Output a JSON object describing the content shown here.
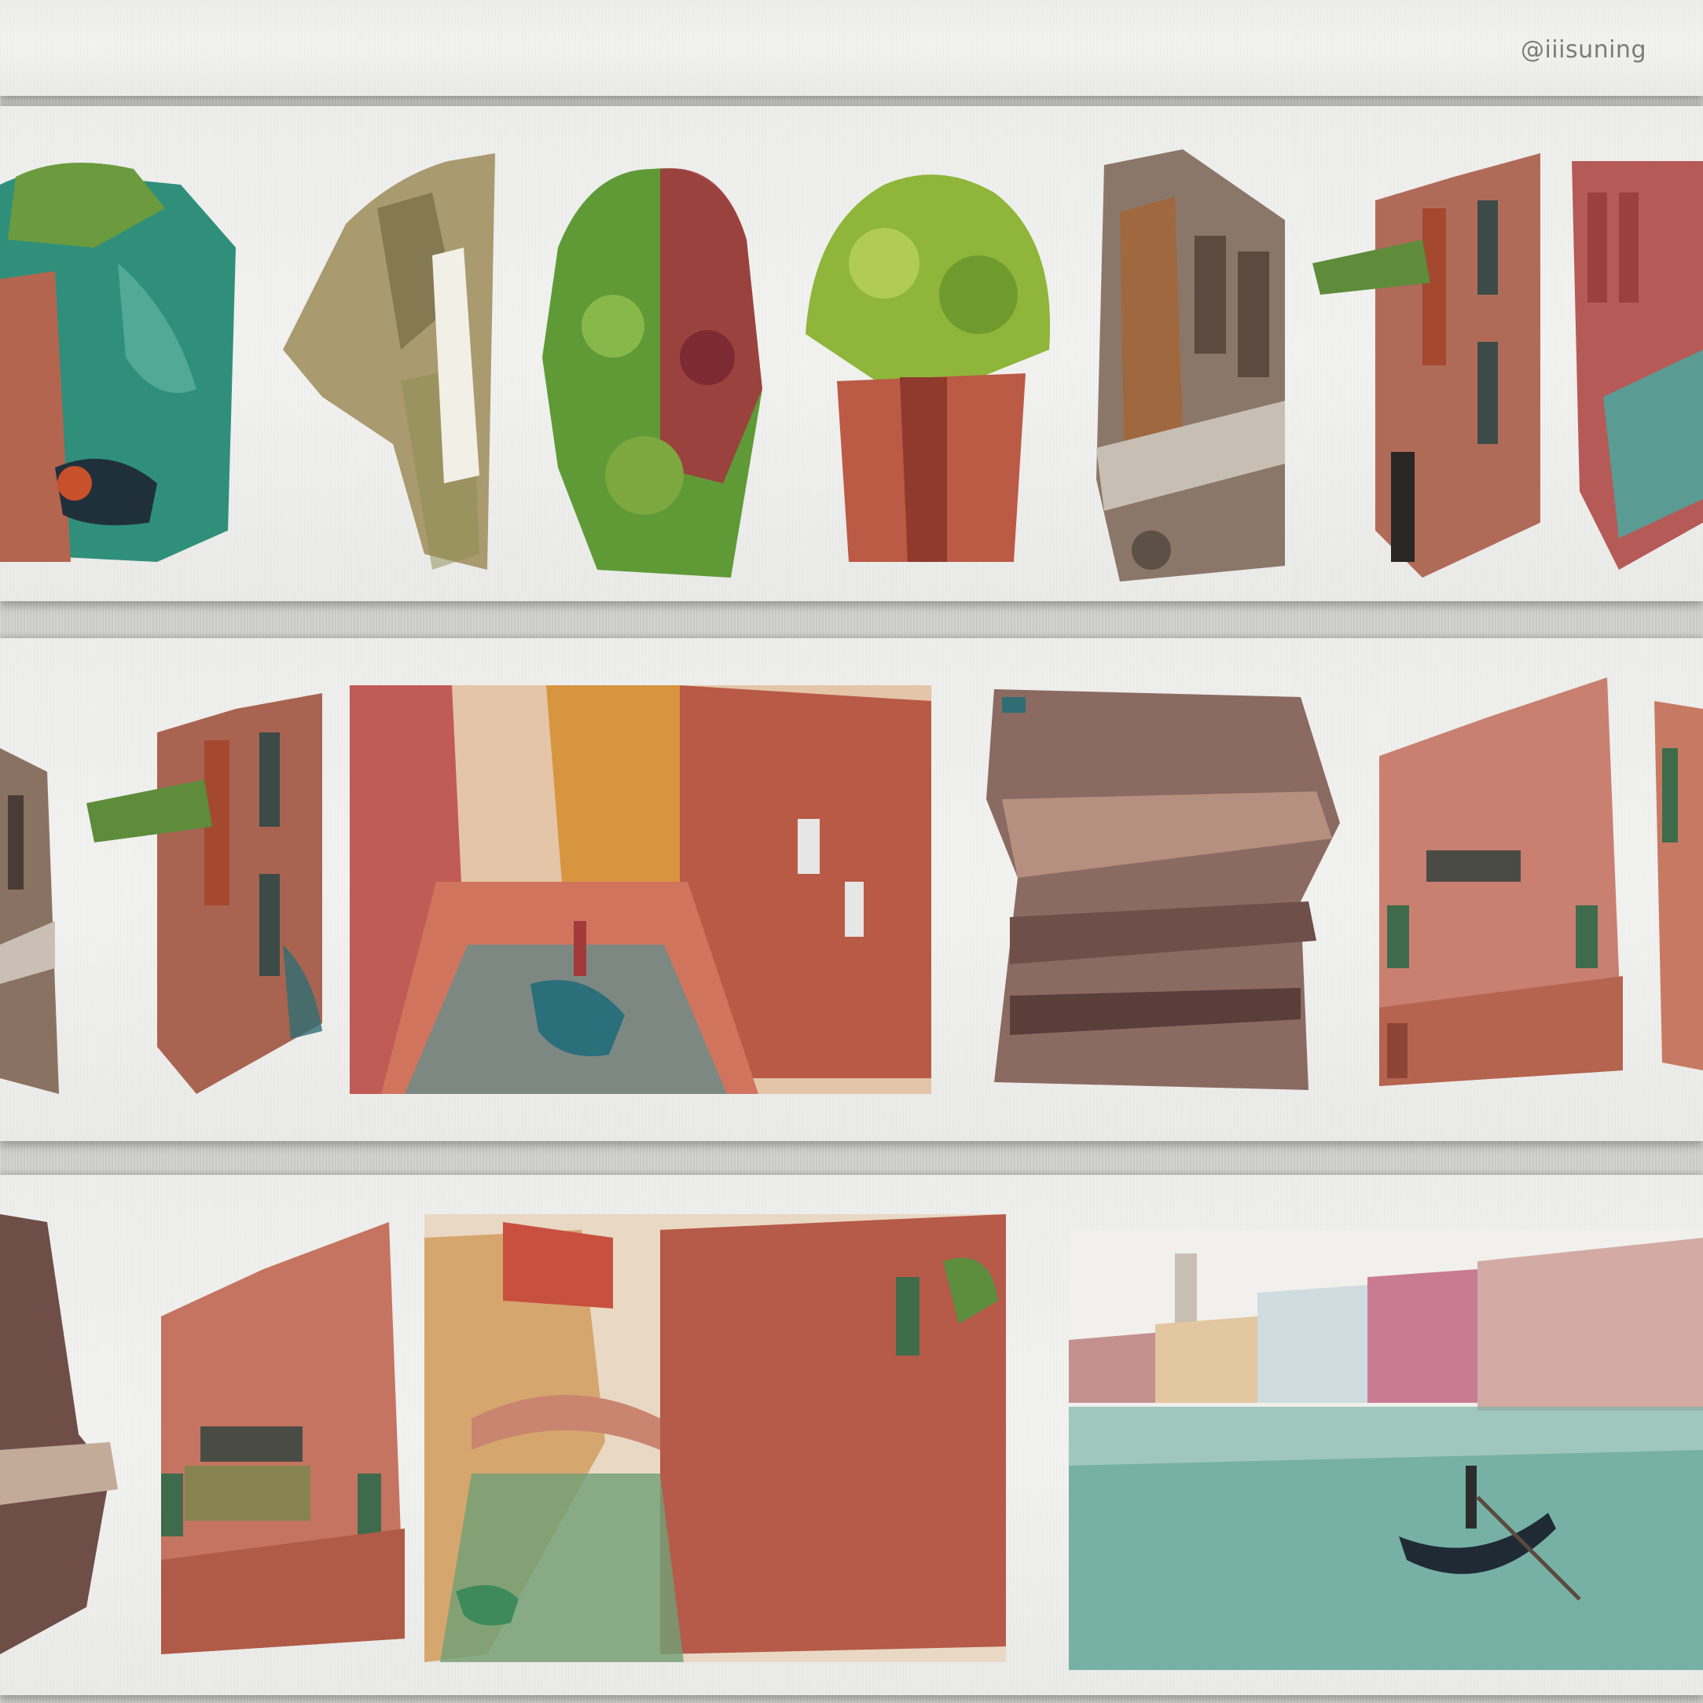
{
  "watermark": {
    "text": "@iiisuning"
  },
  "colors": {
    "tape": "#f0f0ee",
    "brick": "#b5543f",
    "canal": "#3f9a92",
    "foliage": "#7da43c",
    "stone": "#8a7466"
  },
  "strips": [
    {
      "tiles": [
        "canal-corner-with-boat",
        "ochre-wall-fragment",
        "climbing-green-red-plant",
        "potted-green-plant",
        "grey-stone-facade",
        "brick-house-with-balcony",
        "red-building-edge"
      ]
    },
    {
      "tiles": [
        "partial-facade",
        "brick-house-with-balcony",
        "narrow-canal-with-gondola",
        "wooden-pier-planks",
        "red-house-with-shutters",
        "partial-red-house"
      ]
    },
    {
      "tiles": [
        "partial-dark-brick",
        "red-house-with-shutters",
        "canal-with-bridge",
        "grand-canal-panorama-with-gondola"
      ]
    }
  ]
}
